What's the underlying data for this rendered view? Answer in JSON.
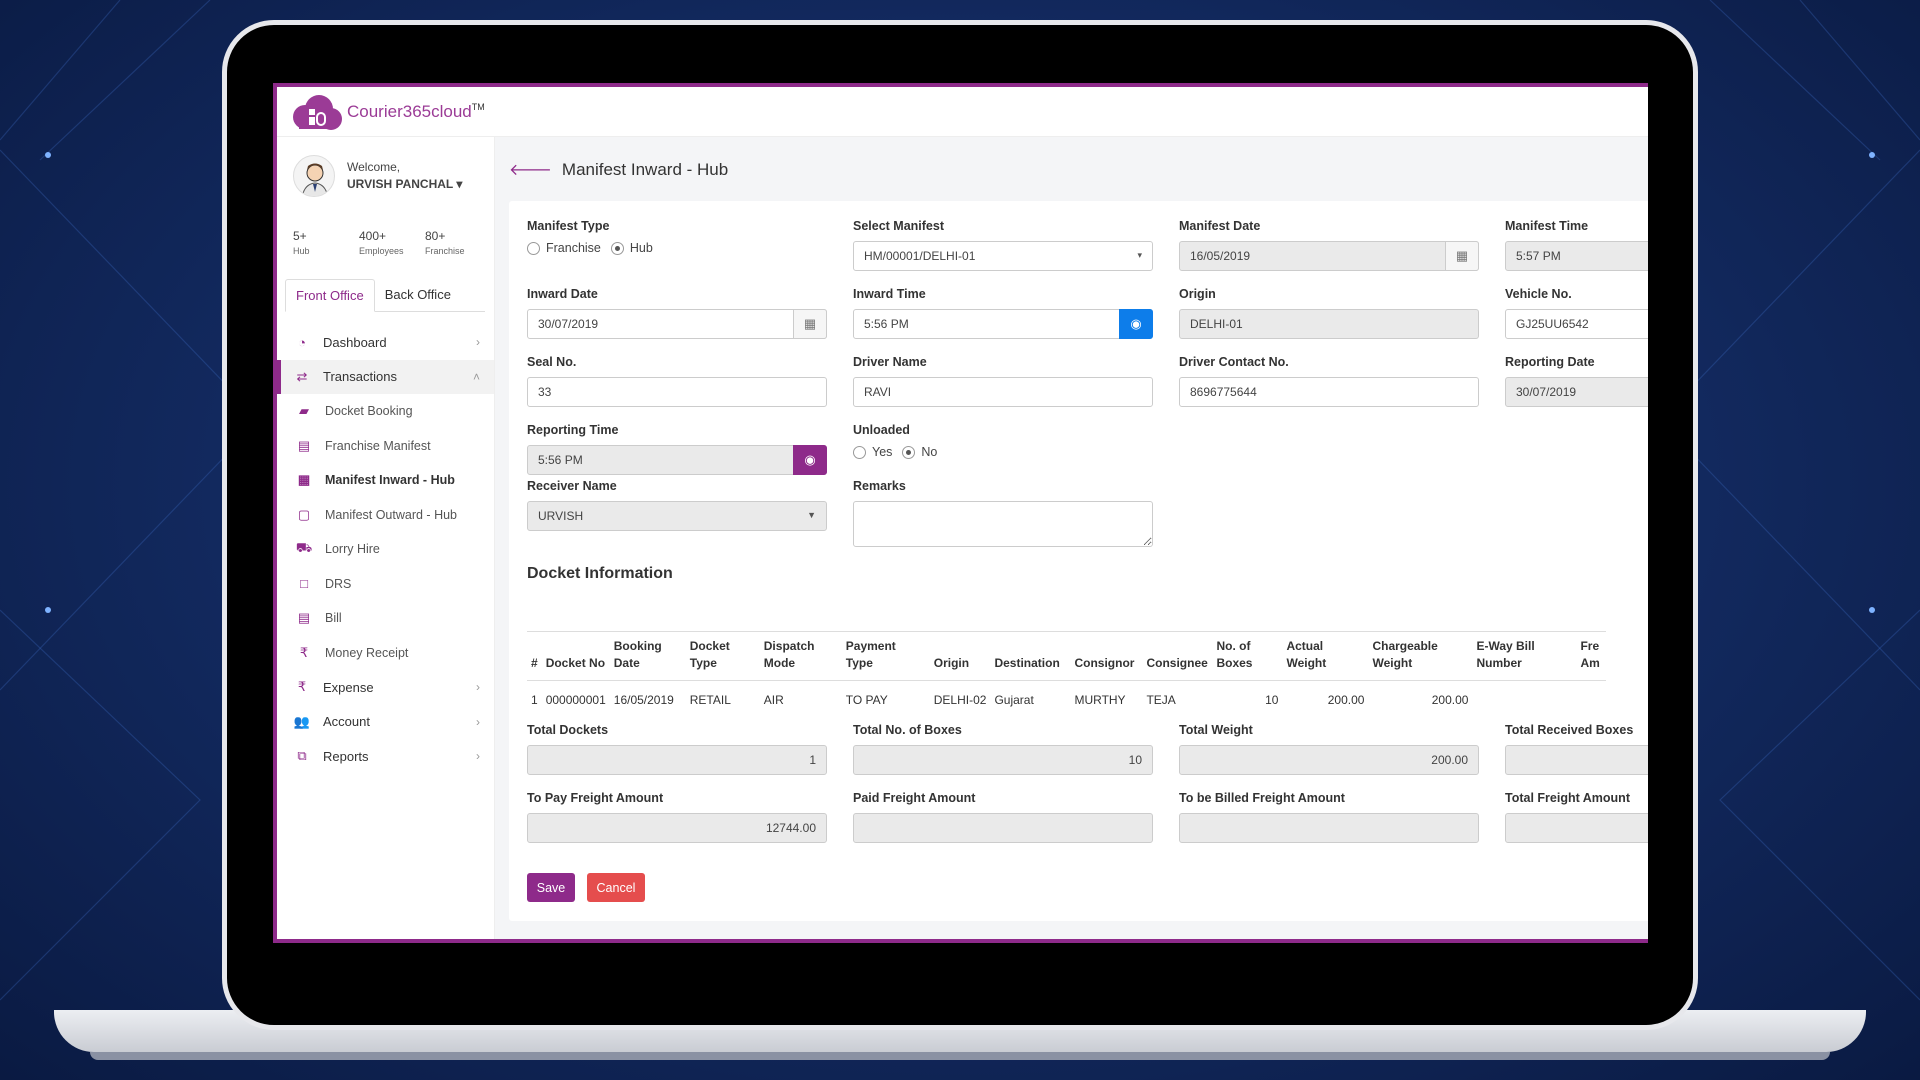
{
  "app": {
    "logo_text": "Courier365cloud",
    "trademark": "TM"
  },
  "user": {
    "welcome": "Welcome,",
    "name": "URVISH PANCHAL"
  },
  "stats": [
    {
      "value": "5+",
      "label": "Hub"
    },
    {
      "value": "400+",
      "label": "Employees"
    },
    {
      "value": "80+",
      "label": "Franchise"
    }
  ],
  "tabs": {
    "front": "Front Office",
    "back": "Back Office"
  },
  "menu": {
    "dashboard": "Dashboard",
    "transactions": "Transactions",
    "docket_booking": "Docket Booking",
    "franchise_manifest": "Franchise Manifest",
    "manifest_inward": "Manifest Inward - Hub",
    "manifest_outward": "Manifest Outward - Hub",
    "lorry_hire": "Lorry Hire",
    "drs": "DRS",
    "bill": "Bill",
    "money_receipt": "Money Receipt",
    "expense": "Expense",
    "account": "Account",
    "reports": "Reports"
  },
  "page": {
    "title": "Manifest Inward - Hub"
  },
  "form": {
    "manifest_type": {
      "label": "Manifest Type",
      "options": [
        "Franchise",
        "Hub"
      ],
      "selected": "Hub"
    },
    "select_manifest": {
      "label": "Select Manifest",
      "value": "HM/00001/DELHI-01"
    },
    "manifest_date": {
      "label": "Manifest Date",
      "value": "16/05/2019"
    },
    "manifest_time": {
      "label": "Manifest Time",
      "value": "5:57 PM"
    },
    "inward_date": {
      "label": "Inward Date",
      "value": "30/07/2019"
    },
    "inward_time": {
      "label": "Inward Time",
      "value": "5:56 PM"
    },
    "origin": {
      "label": "Origin",
      "value": "DELHI-01"
    },
    "vehicle_no": {
      "label": "Vehicle No.",
      "value": "GJ25UU6542"
    },
    "seal_no": {
      "label": "Seal No.",
      "value": "33"
    },
    "driver_name": {
      "label": "Driver Name",
      "value": "RAVI"
    },
    "driver_contact": {
      "label": "Driver Contact No.",
      "value": "8696775644"
    },
    "reporting_date": {
      "label": "Reporting Date",
      "value": "30/07/2019"
    },
    "reporting_time": {
      "label": "Reporting Time",
      "value": "5:56 PM"
    },
    "unloaded": {
      "label": "Unloaded",
      "options": [
        "Yes",
        "No"
      ],
      "selected": "No"
    },
    "receiver_name": {
      "label": "Receiver Name",
      "value": "URVISH"
    },
    "remarks": {
      "label": "Remarks",
      "value": ""
    }
  },
  "docket": {
    "title": "Docket Information",
    "headers": [
      "#",
      "Docket No",
      "Booking\nDate",
      "Docket\nType",
      "Dispatch\nMode",
      "Payment\nType",
      "Origin",
      "Destination",
      "Consignor",
      "Consignee",
      "No. of\nBoxes",
      "Actual\nWeight",
      "Chargeable\nWeight",
      "E-Way Bill\nNumber",
      "Fre\nAm"
    ],
    "rows": [
      [
        "1",
        "000000001",
        "16/05/2019",
        "RETAIL",
        "AIR",
        "TO PAY",
        "DELHI-02",
        "Gujarat",
        "MURTHY",
        "TEJA",
        "10",
        "200.00",
        "200.00",
        "",
        ""
      ]
    ]
  },
  "totals": {
    "total_dockets": {
      "label": "Total Dockets",
      "value": "1"
    },
    "total_boxes": {
      "label": "Total No. of Boxes",
      "value": "10"
    },
    "total_weight": {
      "label": "Total Weight",
      "value": "200.00"
    },
    "total_received_boxes": {
      "label": "Total Received Boxes",
      "value": ""
    },
    "to_pay_freight": {
      "label": "To Pay Freight Amount",
      "value": "12744.00"
    },
    "paid_freight": {
      "label": "Paid Freight Amount",
      "value": ""
    },
    "to_be_billed_freight": {
      "label": "To be Billed Freight Amount",
      "value": ""
    },
    "total_freight": {
      "label": "Total Freight Amount",
      "value": ""
    }
  },
  "buttons": {
    "save": "Save",
    "cancel": "Cancel"
  },
  "colors": {
    "brand": "#8e2a8a",
    "primary_blue": "#0d7dea",
    "cancel_red": "#e54d4d"
  }
}
